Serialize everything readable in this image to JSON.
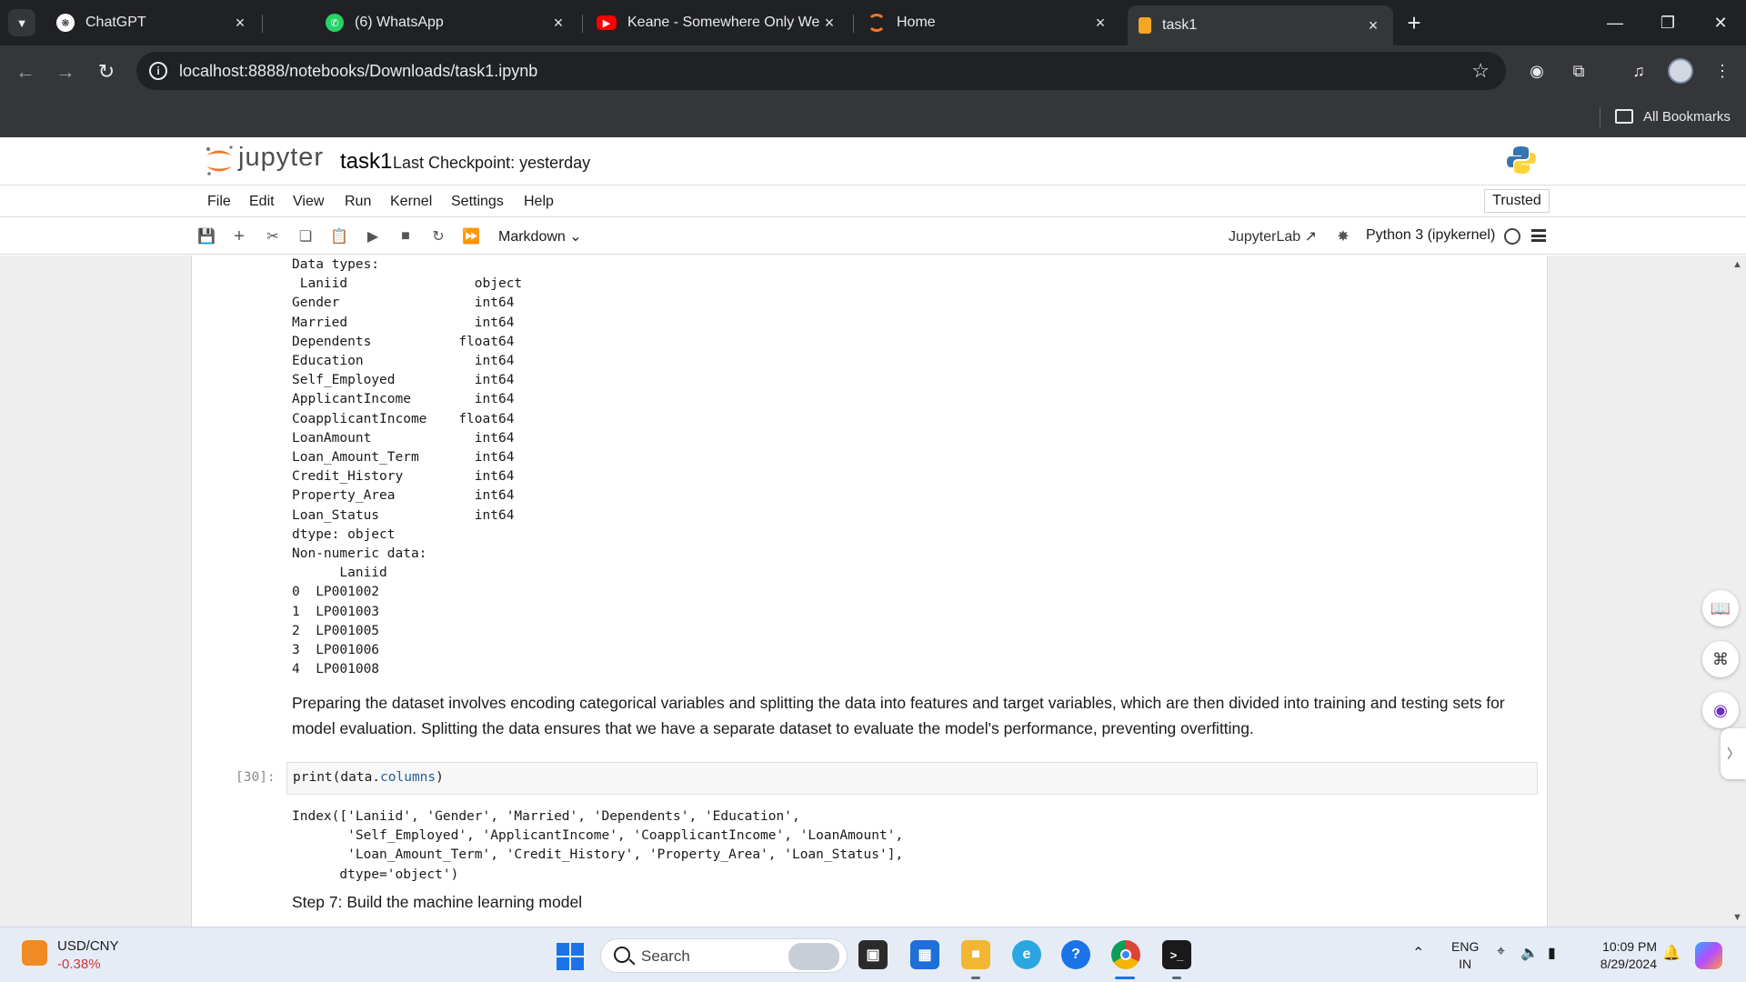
{
  "browser": {
    "tabs": [
      {
        "label": "ChatGPT",
        "icon": "chatgpt-icon"
      },
      {
        "label": "(6) WhatsApp",
        "icon": "whatsapp-icon"
      },
      {
        "label": "Keane - Somewhere Only We Kn",
        "icon": "youtube-icon"
      },
      {
        "label": "Home",
        "icon": "jupyter-icon"
      },
      {
        "label": "task1",
        "icon": "notebook-icon",
        "active": true
      }
    ],
    "url": "localhost:8888/notebooks/Downloads/task1.ipynb",
    "bookmarks_label": "All Bookmarks"
  },
  "jupyter": {
    "wordmark": "jupyter",
    "notebook_title": "task1",
    "checkpoint": "Last Checkpoint: yesterday",
    "menu": [
      "File",
      "Edit",
      "View",
      "Run",
      "Kernel",
      "Settings",
      "Help"
    ],
    "trusted": "Trusted",
    "cell_type": "Markdown",
    "jupyterlab_link": "JupyterLab",
    "kernel": "Python 3 (ipykernel)"
  },
  "notebook": {
    "output_dtypes_lines": [
      "Data types:",
      " Laniid                object",
      "Gender                 int64",
      "Married                int64",
      "Dependents           float64",
      "Education              int64",
      "Self_Employed          int64",
      "ApplicantIncome        int64",
      "CoapplicantIncome    float64",
      "LoanAmount             int64",
      "Loan_Amount_Term       int64",
      "Credit_History         int64",
      "Property_Area          int64",
      "Loan_Status            int64",
      "dtype: object",
      "Non-numeric data:",
      "      Laniid",
      "0  LP001002",
      "1  LP001003",
      "2  LP001005",
      "3  LP001006",
      "4  LP001008"
    ],
    "markdown_text": "Preparing the dataset involves encoding categorical variables and splitting the data into features and target variables, which are then divided into training and testing sets for model evaluation. Splitting the data ensures that we have a separate dataset to evaluate the model's performance, preventing overfitting.",
    "prompt": "[30]:",
    "code_prefix": "print(data.",
    "code_attr": "columns",
    "code_suffix": ")",
    "output_columns_lines": [
      "Index(['Laniid', 'Gender', 'Married', 'Dependents', 'Education',",
      "       'Self_Employed', 'ApplicantIncome', 'CoapplicantIncome', 'LoanAmount',",
      "       'Loan_Amount_Term', 'Credit_History', 'Property_Area', 'Loan_Status'],",
      "      dtype='object')"
    ],
    "step_text": "Step 7: Build the machine learning model"
  },
  "taskbar": {
    "widget_name": "USD/CNY",
    "widget_value": "-0.38%",
    "search_label": "Search",
    "lang_top": "ENG",
    "lang_bottom": "IN",
    "time": "10:09 PM",
    "date": "8/29/2024"
  }
}
